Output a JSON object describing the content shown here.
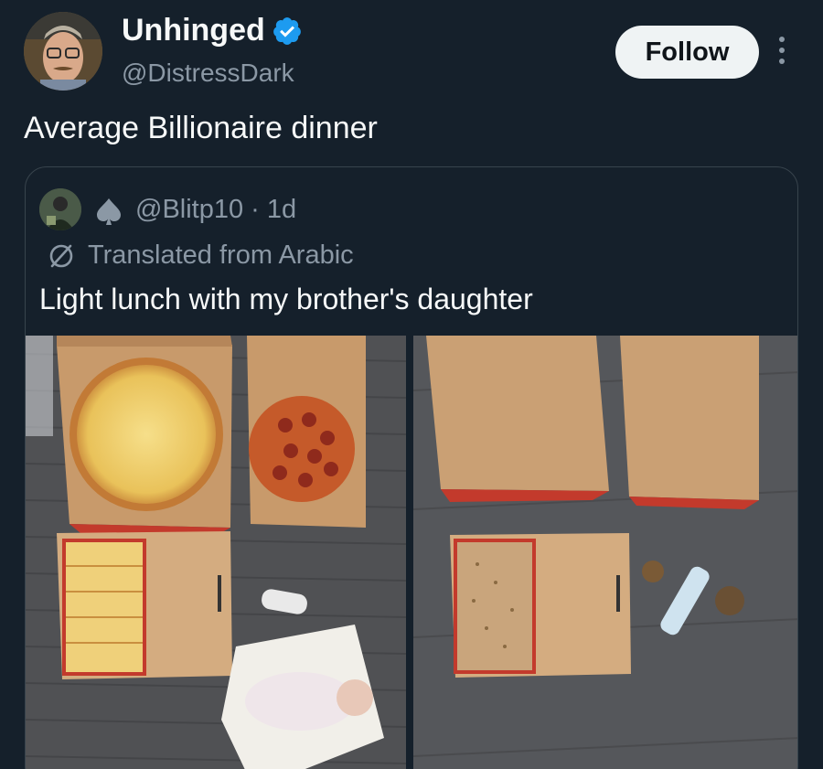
{
  "author": {
    "display_name": "Unhinged",
    "handle": "@DistressDark",
    "verified": true,
    "verified_icon": "verified-badge-icon",
    "verified_color": "#1d9bf0"
  },
  "follow_label": "Follow",
  "more_icon": "more-vertical-icon",
  "tweet_text": "Average Billionaire dinner",
  "quoted": {
    "handle_line": "@Blitp10 · 1d",
    "badge_icon": "spade-icon",
    "translated_label": "Translated from Arabic",
    "translate_icon": "translate-icon",
    "text": "Light lunch with my brother's daughter",
    "media": [
      {
        "description_icon": "photo-full-pizzas"
      },
      {
        "description_icon": "photo-empty-boxes"
      }
    ]
  },
  "colors": {
    "background": "#15202b",
    "text_primary": "#f7f9f9",
    "text_secondary": "#8b98a5",
    "border": "#38444d",
    "follow_bg": "#eff3f4",
    "follow_text": "#0f1419"
  }
}
